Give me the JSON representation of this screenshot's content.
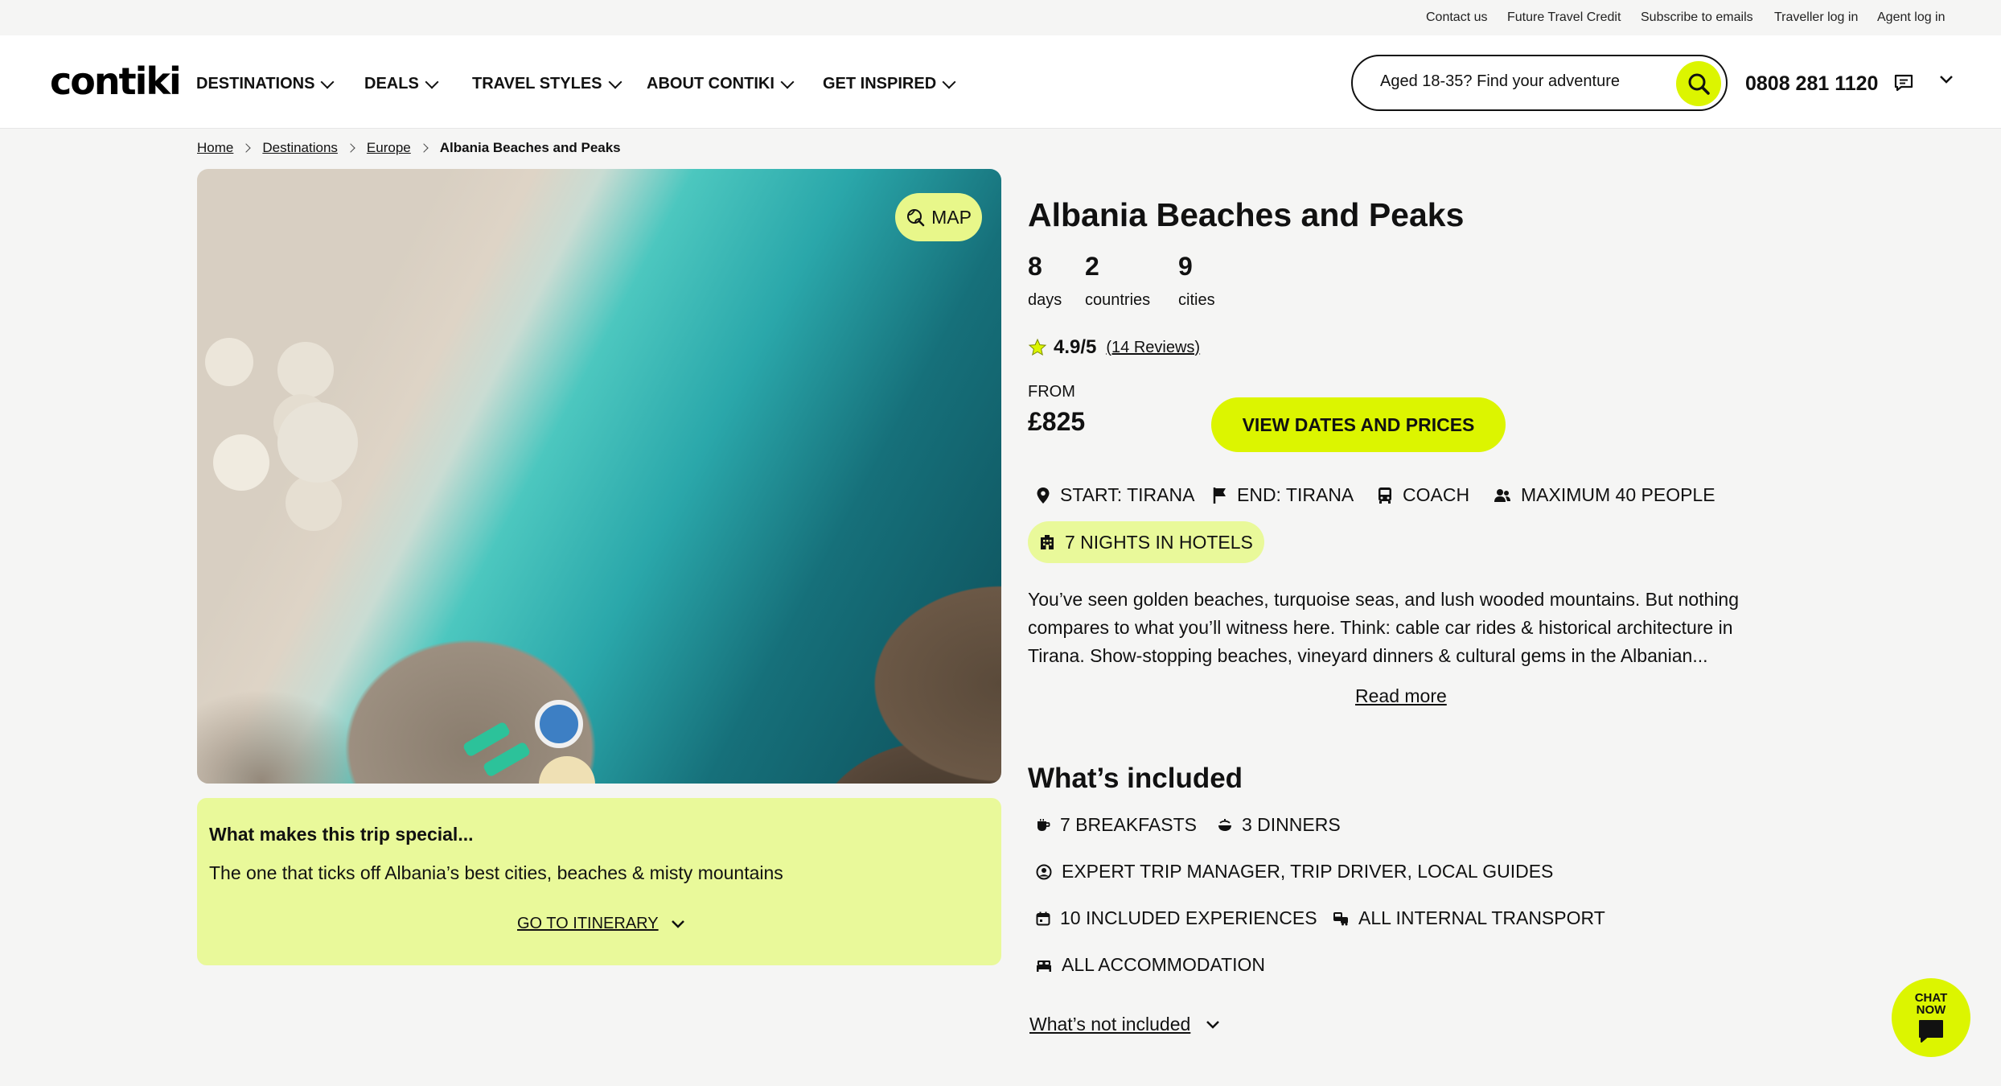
{
  "utility_links": [
    "Contact us",
    "Future Travel Credit",
    "Subscribe to emails",
    "Traveller log in",
    "Agent log in"
  ],
  "header": {
    "logo": "contiki",
    "nav": [
      "DESTINATIONS",
      "DEALS",
      "TRAVEL STYLES",
      "ABOUT CONTIKI",
      "GET INSPIRED"
    ],
    "search_placeholder": "Aged 18-35? Find your adventure",
    "phone": "0808 281 1120"
  },
  "breadcrumb": [
    "Home",
    "Destinations",
    "Europe",
    "Albania Beaches and Peaks"
  ],
  "hero": {
    "map_label": "MAP"
  },
  "special": {
    "heading": "What makes this trip special...",
    "text": "The one that ticks off Albania’s best cities, beaches & misty mountains",
    "link": "GO TO ITINERARY"
  },
  "trip": {
    "title": "Albania Beaches and Peaks",
    "stats": [
      {
        "value": "8",
        "label": "days"
      },
      {
        "value": "2",
        "label": "countries"
      },
      {
        "value": "9",
        "label": "cities"
      }
    ],
    "rating": "4.9/5",
    "reviews": "(14 Reviews)",
    "from_label": "FROM",
    "price": "£825",
    "cta": "VIEW DATES AND PRICES",
    "features": [
      "START: TIRANA",
      "END: TIRANA",
      "COACH",
      "MAXIMUM 40 PEOPLE"
    ],
    "hotels": "7 NIGHTS IN HOTELS",
    "description": "You’ve seen golden beaches, turquoise seas, and lush wooded mountains. But nothing compares to what you’ll witness here. Think: cable car rides & historical architecture in Tirana. Show-stopping beaches, vineyard dinners & cultural gems in the Albanian...",
    "read_more": "Read more"
  },
  "included": {
    "title": "What’s included",
    "items": [
      "7 BREAKFASTS",
      "3 DINNERS",
      "EXPERT TRIP MANAGER, TRIP DRIVER, LOCAL GUIDES",
      "10 INCLUDED EXPERIENCES",
      "ALL INTERNAL TRANSPORT",
      "ALL ACCOMMODATION"
    ],
    "not_included": "What’s not included"
  },
  "chat": {
    "label_1": "CHAT",
    "label_2": "NOW"
  },
  "colors": {
    "accent": "#dcf500",
    "accent_light": "#e9f99a",
    "text": "#111111",
    "background": "#f5f5f4"
  }
}
